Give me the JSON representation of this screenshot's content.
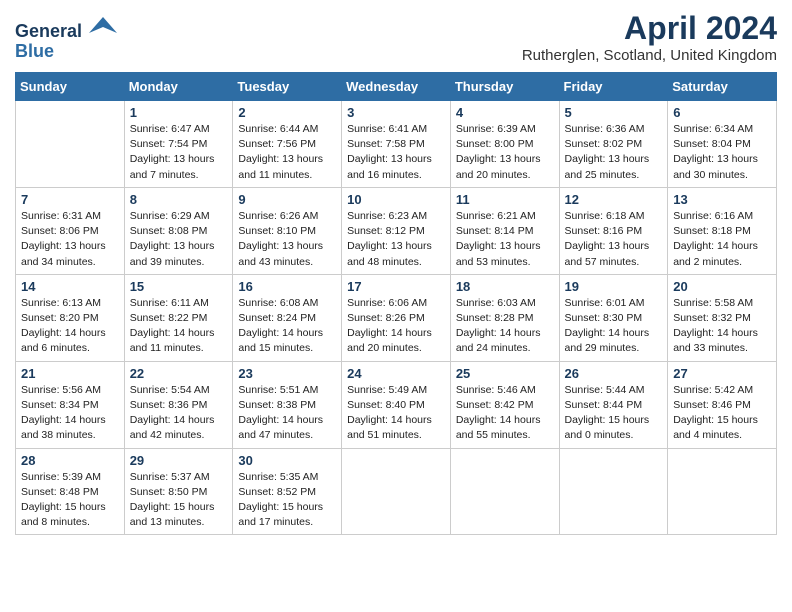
{
  "header": {
    "logo_line1": "General",
    "logo_line2": "Blue",
    "month_year": "April 2024",
    "location": "Rutherglen, Scotland, United Kingdom"
  },
  "weekdays": [
    "Sunday",
    "Monday",
    "Tuesday",
    "Wednesday",
    "Thursday",
    "Friday",
    "Saturday"
  ],
  "weeks": [
    [
      {
        "day": "",
        "info": ""
      },
      {
        "day": "1",
        "info": "Sunrise: 6:47 AM\nSunset: 7:54 PM\nDaylight: 13 hours\nand 7 minutes."
      },
      {
        "day": "2",
        "info": "Sunrise: 6:44 AM\nSunset: 7:56 PM\nDaylight: 13 hours\nand 11 minutes."
      },
      {
        "day": "3",
        "info": "Sunrise: 6:41 AM\nSunset: 7:58 PM\nDaylight: 13 hours\nand 16 minutes."
      },
      {
        "day": "4",
        "info": "Sunrise: 6:39 AM\nSunset: 8:00 PM\nDaylight: 13 hours\nand 20 minutes."
      },
      {
        "day": "5",
        "info": "Sunrise: 6:36 AM\nSunset: 8:02 PM\nDaylight: 13 hours\nand 25 minutes."
      },
      {
        "day": "6",
        "info": "Sunrise: 6:34 AM\nSunset: 8:04 PM\nDaylight: 13 hours\nand 30 minutes."
      }
    ],
    [
      {
        "day": "7",
        "info": "Sunrise: 6:31 AM\nSunset: 8:06 PM\nDaylight: 13 hours\nand 34 minutes."
      },
      {
        "day": "8",
        "info": "Sunrise: 6:29 AM\nSunset: 8:08 PM\nDaylight: 13 hours\nand 39 minutes."
      },
      {
        "day": "9",
        "info": "Sunrise: 6:26 AM\nSunset: 8:10 PM\nDaylight: 13 hours\nand 43 minutes."
      },
      {
        "day": "10",
        "info": "Sunrise: 6:23 AM\nSunset: 8:12 PM\nDaylight: 13 hours\nand 48 minutes."
      },
      {
        "day": "11",
        "info": "Sunrise: 6:21 AM\nSunset: 8:14 PM\nDaylight: 13 hours\nand 53 minutes."
      },
      {
        "day": "12",
        "info": "Sunrise: 6:18 AM\nSunset: 8:16 PM\nDaylight: 13 hours\nand 57 minutes."
      },
      {
        "day": "13",
        "info": "Sunrise: 6:16 AM\nSunset: 8:18 PM\nDaylight: 14 hours\nand 2 minutes."
      }
    ],
    [
      {
        "day": "14",
        "info": "Sunrise: 6:13 AM\nSunset: 8:20 PM\nDaylight: 14 hours\nand 6 minutes."
      },
      {
        "day": "15",
        "info": "Sunrise: 6:11 AM\nSunset: 8:22 PM\nDaylight: 14 hours\nand 11 minutes."
      },
      {
        "day": "16",
        "info": "Sunrise: 6:08 AM\nSunset: 8:24 PM\nDaylight: 14 hours\nand 15 minutes."
      },
      {
        "day": "17",
        "info": "Sunrise: 6:06 AM\nSunset: 8:26 PM\nDaylight: 14 hours\nand 20 minutes."
      },
      {
        "day": "18",
        "info": "Sunrise: 6:03 AM\nSunset: 8:28 PM\nDaylight: 14 hours\nand 24 minutes."
      },
      {
        "day": "19",
        "info": "Sunrise: 6:01 AM\nSunset: 8:30 PM\nDaylight: 14 hours\nand 29 minutes."
      },
      {
        "day": "20",
        "info": "Sunrise: 5:58 AM\nSunset: 8:32 PM\nDaylight: 14 hours\nand 33 minutes."
      }
    ],
    [
      {
        "day": "21",
        "info": "Sunrise: 5:56 AM\nSunset: 8:34 PM\nDaylight: 14 hours\nand 38 minutes."
      },
      {
        "day": "22",
        "info": "Sunrise: 5:54 AM\nSunset: 8:36 PM\nDaylight: 14 hours\nand 42 minutes."
      },
      {
        "day": "23",
        "info": "Sunrise: 5:51 AM\nSunset: 8:38 PM\nDaylight: 14 hours\nand 47 minutes."
      },
      {
        "day": "24",
        "info": "Sunrise: 5:49 AM\nSunset: 8:40 PM\nDaylight: 14 hours\nand 51 minutes."
      },
      {
        "day": "25",
        "info": "Sunrise: 5:46 AM\nSunset: 8:42 PM\nDaylight: 14 hours\nand 55 minutes."
      },
      {
        "day": "26",
        "info": "Sunrise: 5:44 AM\nSunset: 8:44 PM\nDaylight: 15 hours\nand 0 minutes."
      },
      {
        "day": "27",
        "info": "Sunrise: 5:42 AM\nSunset: 8:46 PM\nDaylight: 15 hours\nand 4 minutes."
      }
    ],
    [
      {
        "day": "28",
        "info": "Sunrise: 5:39 AM\nSunset: 8:48 PM\nDaylight: 15 hours\nand 8 minutes."
      },
      {
        "day": "29",
        "info": "Sunrise: 5:37 AM\nSunset: 8:50 PM\nDaylight: 15 hours\nand 13 minutes."
      },
      {
        "day": "30",
        "info": "Sunrise: 5:35 AM\nSunset: 8:52 PM\nDaylight: 15 hours\nand 17 minutes."
      },
      {
        "day": "",
        "info": ""
      },
      {
        "day": "",
        "info": ""
      },
      {
        "day": "",
        "info": ""
      },
      {
        "day": "",
        "info": ""
      }
    ]
  ]
}
